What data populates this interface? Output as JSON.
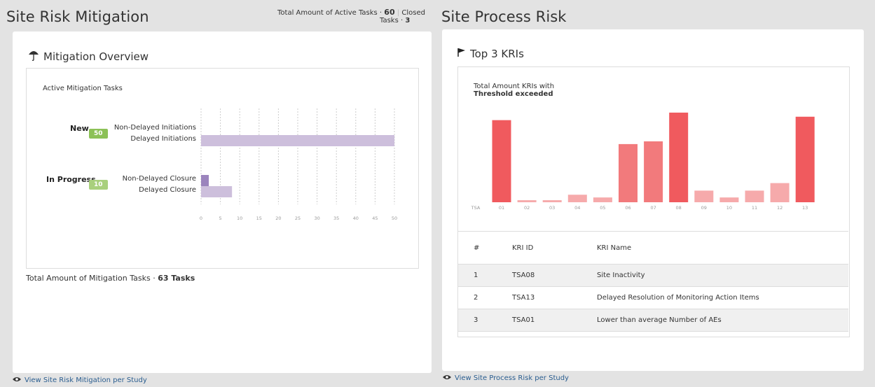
{
  "left_panel": {
    "title": "Site Risk Mitigation",
    "active_label": "Total Amount of Active Tasks",
    "sep": "·",
    "active_count": "60",
    "closed_label_1": "Closed",
    "closed_label_2": "Tasks",
    "closed_count": "3",
    "card_title": "Mitigation Overview",
    "inner_title": "Active Mitigation Tasks",
    "footer_label": "Total Amount of Mitigation Tasks",
    "footer_value": "63 Tasks",
    "view_link": "View Site Risk Mitigation per Study"
  },
  "chart_data": [
    {
      "type": "bar",
      "orientation": "horizontal",
      "title": "Active Mitigation Tasks",
      "groups": [
        {
          "label": "New",
          "badge": "50",
          "categories": [
            "Non-Delayed Initiations",
            "Delayed Initiations"
          ],
          "values": [
            0,
            50
          ]
        },
        {
          "label": "In Progress",
          "badge": "10",
          "categories": [
            "Non-Delayed Closure",
            "Delayed Closure"
          ],
          "values": [
            2,
            8
          ]
        }
      ],
      "xlim": [
        0,
        50
      ],
      "x_ticks": [
        "0",
        "5",
        "10",
        "15",
        "20",
        "25",
        "30",
        "35",
        "40",
        "45",
        "50"
      ],
      "grid": "vertical dashed",
      "colors": {
        "bar": "#cdbfdc",
        "bar_highlight": "#9b84bd"
      }
    },
    {
      "type": "bar",
      "title": "Total Amount KRIs with",
      "title_bold": "Threshold exceeded",
      "x_prefix": "TSA",
      "categories": [
        "01",
        "02",
        "03",
        "04",
        "05",
        "06",
        "07",
        "08",
        "09",
        "10",
        "11",
        "12",
        "13"
      ],
      "values": [
        120,
        3,
        3,
        11,
        7,
        85,
        89,
        131,
        17,
        7,
        17,
        28,
        125
      ],
      "ylim": [
        0,
        135
      ],
      "colors": {
        "high": "#f05a5e",
        "mid": "#f27a7c",
        "low": "#f6aaab"
      },
      "levels": [
        "high",
        "low",
        "low",
        "low",
        "low",
        "mid",
        "mid",
        "high",
        "low",
        "low",
        "low",
        "low",
        "high"
      ]
    }
  ],
  "right_panel": {
    "title": "Site Process Risk",
    "card_title": "Top 3 KRIs",
    "table": {
      "headers": [
        "#",
        "KRI ID",
        "KRI Name"
      ],
      "rows": [
        [
          "1",
          "TSA08",
          "Site Inactivity"
        ],
        [
          "2",
          "TSA13",
          "Delayed Resolution of Monitoring Action Items"
        ],
        [
          "3",
          "TSA01",
          "Lower than average Number of AEs"
        ]
      ]
    },
    "view_link": "View Site Process Risk per Study"
  }
}
